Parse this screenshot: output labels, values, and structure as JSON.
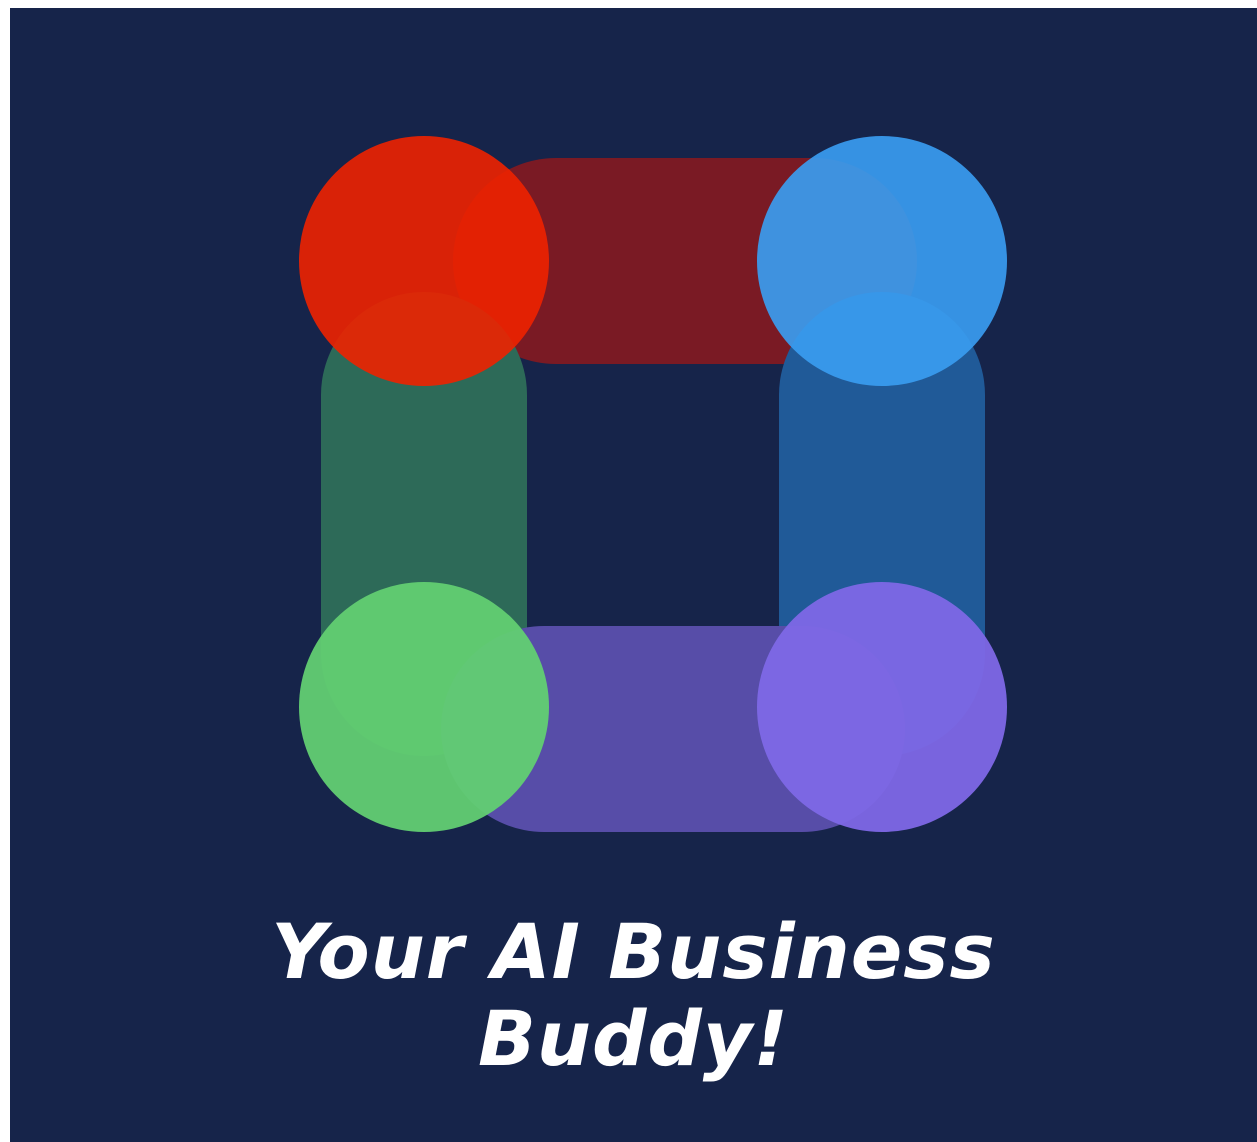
{
  "tagline": {
    "line1": "Your AI Business",
    "line2": "Buddy!"
  },
  "logo": {
    "icon": "four-circle-square-logo",
    "colors": {
      "background": "#16244a",
      "red_circle": "#ee2200",
      "red_bar": "#7a1a24",
      "blue_circle": "#3a9cf0",
      "blue_bar": "#205a98",
      "green_circle": "#62cf72",
      "green_bar": "#2d6a58",
      "purple_circle": "#7e68e6",
      "purple_bar": "#574da8"
    }
  }
}
